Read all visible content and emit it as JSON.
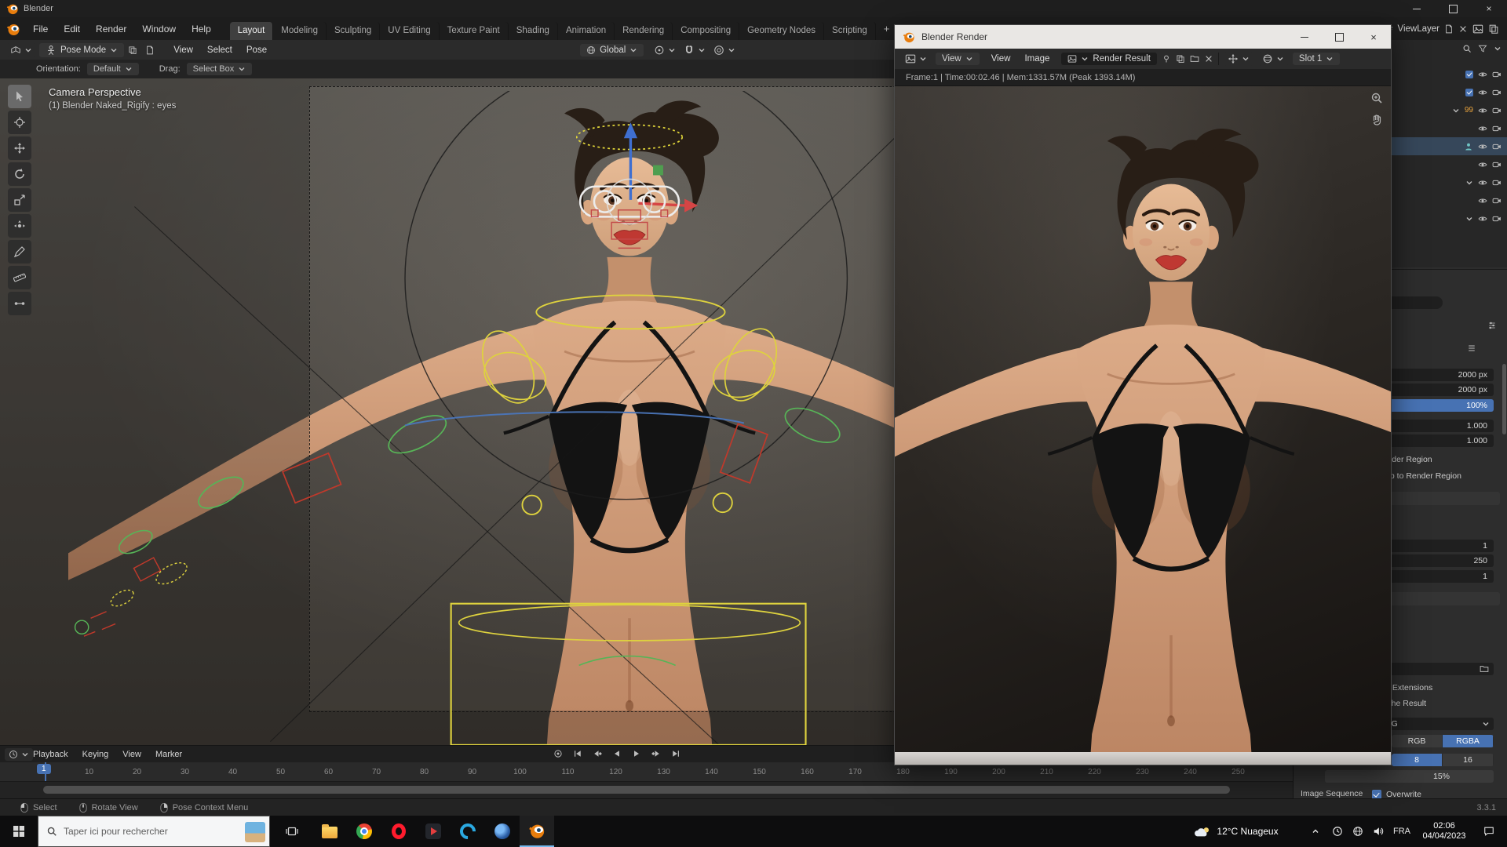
{
  "window": {
    "title": "Blender"
  },
  "menubar": [
    "File",
    "Edit",
    "Render",
    "Window",
    "Help"
  ],
  "workspaces": {
    "tabs": [
      {
        "label": "Layout",
        "active": true
      },
      {
        "label": "Modeling"
      },
      {
        "label": "Sculpting"
      },
      {
        "label": "UV Editing"
      },
      {
        "label": "Texture Paint"
      },
      {
        "label": "Shading"
      },
      {
        "label": "Animation"
      },
      {
        "label": "Rendering"
      },
      {
        "label": "Compositing"
      },
      {
        "label": "Geometry Nodes"
      },
      {
        "label": "Scripting"
      }
    ],
    "add_label": "+"
  },
  "topbar_right": {
    "view_layer": "ViewLayer"
  },
  "viewport": {
    "header": {
      "mode": "Pose Mode",
      "menus": [
        "View",
        "Select",
        "Pose"
      ],
      "orientation": "Global"
    },
    "tool_settings": {
      "orientation_label": "Orientation:",
      "orientation_value": "Default",
      "drag_label": "Drag:",
      "drag_value": "Select Box"
    },
    "overlay_line1": "Camera Perspective",
    "overlay_line2": "(1) Blender Naked_Rigify : eyes",
    "tools": [
      "select-box",
      "cursor",
      "move",
      "rotate",
      "scale",
      "transform",
      "annotate",
      "measure",
      "pose-breakdowner"
    ]
  },
  "timeline": {
    "menus": [
      "Playback",
      "Keying",
      "View",
      "Marker"
    ],
    "current_frame": "1",
    "ticks": [
      "10",
      "20",
      "30",
      "40",
      "50",
      "60",
      "70",
      "80",
      "90",
      "100",
      "110",
      "120",
      "130",
      "140",
      "150",
      "160",
      "170",
      "180",
      "190",
      "200",
      "210",
      "220",
      "230",
      "240",
      "250"
    ]
  },
  "statusbar": {
    "items": [
      {
        "label": "Select"
      },
      {
        "label": "Rotate View"
      },
      {
        "label": "Pose Context Menu"
      }
    ],
    "version": "3.3.1"
  },
  "render_window": {
    "title": "Blender Render",
    "header": {
      "mode": "View",
      "menus": [
        "View",
        "Image"
      ],
      "image_name": "Render Result",
      "slot": "Slot 1"
    },
    "info": "Frame:1 | Time:00:02.46 | Mem:1331.57M (Peak 1393.14M)"
  },
  "outliner": {
    "rows": [
      {
        "checkbox": true,
        "eye": true,
        "camera": true
      },
      {
        "checkbox": true,
        "eye": true,
        "camera": true
      },
      {
        "chevron": true,
        "badge": "99",
        "eye": true,
        "camera": true
      },
      {
        "eye": true,
        "camera": true
      },
      {
        "selected": true,
        "person": true,
        "eye": true,
        "camera": true
      },
      {
        "eye": true,
        "camera": true
      },
      {
        "chevron": true,
        "eye": true,
        "camera": true
      },
      {
        "eye": true,
        "camera": true
      },
      {
        "chevron": true,
        "eye": true,
        "camera": true
      }
    ]
  },
  "properties": {
    "resolution_x": "2000 px",
    "resolution_y": "2000 px",
    "resolution_pct": "100%",
    "aspect_x": "1.000",
    "aspect_y": "1.000",
    "render_region_label": "Render Region",
    "crop_label": "Crop to Render Region",
    "frame_start": "1",
    "frame_end": "250",
    "frame_step": "1",
    "file_extensions_label": "File Extensions",
    "cache_result_label": "Cache Result",
    "file_format": "PNG",
    "color_modes": [
      {
        "label": "RGB"
      },
      {
        "label": "RGBA",
        "active": true
      }
    ],
    "color_depths": [
      {
        "label": "8",
        "active": true
      },
      {
        "label": "16"
      }
    ],
    "compression": "15%",
    "image_sequence_label": "Image Sequence",
    "overwrite_label": "Overwrite"
  },
  "taskbar": {
    "search_placeholder": "Taper ici pour rechercher",
    "weather": "12°C Nuageux",
    "language": "FRA",
    "time": "02:06",
    "date": "04/04/2023",
    "apps": [
      "file-explorer",
      "chrome",
      "opera",
      "media-player",
      "blue-c-app",
      "swirl-app",
      "blender"
    ]
  },
  "colors": {
    "accent": "#4772b3",
    "blender_orange": "#e87d0d"
  }
}
